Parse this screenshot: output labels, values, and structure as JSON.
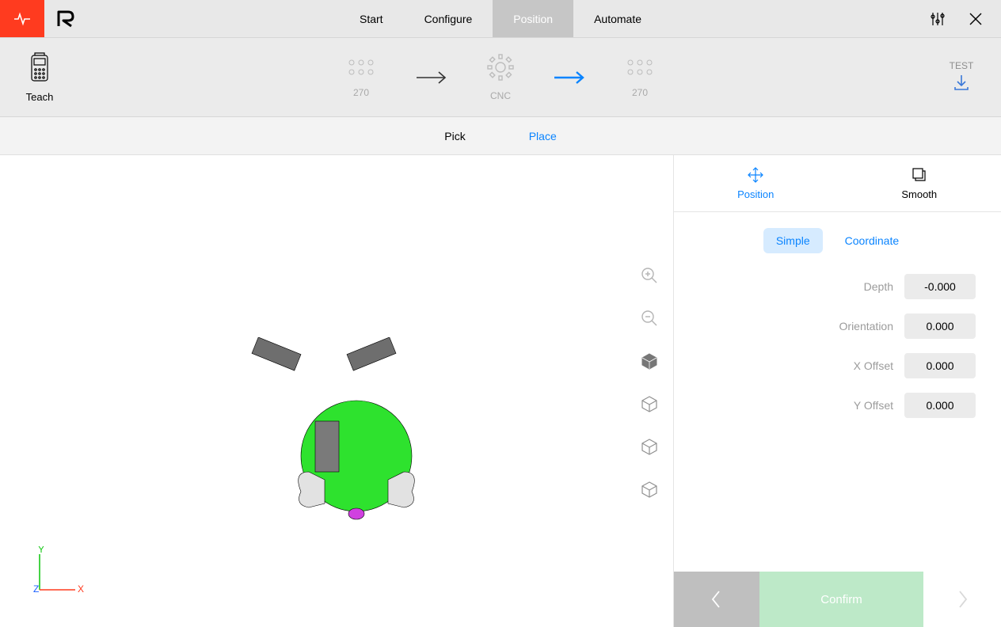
{
  "nav": {
    "tabs": [
      {
        "label": "Start"
      },
      {
        "label": "Configure"
      },
      {
        "label": "Position",
        "active": true
      },
      {
        "label": "Automate"
      }
    ]
  },
  "teach": {
    "label": "Teach"
  },
  "flow": {
    "station1": {
      "name": "270"
    },
    "station2": {
      "name": "CNC"
    },
    "station3": {
      "name": "270"
    }
  },
  "test": {
    "label": "TEST"
  },
  "pickplace": {
    "pick": {
      "label": "Pick"
    },
    "place": {
      "label": "Place",
      "active": true
    }
  },
  "panelTabs": {
    "position": {
      "label": "Position",
      "active": true
    },
    "smooth": {
      "label": "Smooth"
    }
  },
  "mode": {
    "simple": {
      "label": "Simple",
      "active": true
    },
    "coordinate": {
      "label": "Coordinate"
    }
  },
  "fields": {
    "depth": {
      "label": "Depth",
      "value": "-0.000"
    },
    "orientation": {
      "label": "Orientation",
      "value": "0.000"
    },
    "xoffset": {
      "label": "X Offset",
      "value": "0.000"
    },
    "yoffset": {
      "label": "Y Offset",
      "value": "0.000"
    }
  },
  "footer": {
    "confirm": "Confirm"
  },
  "triad": {
    "x": "X",
    "y": "Y",
    "z": "Z"
  }
}
